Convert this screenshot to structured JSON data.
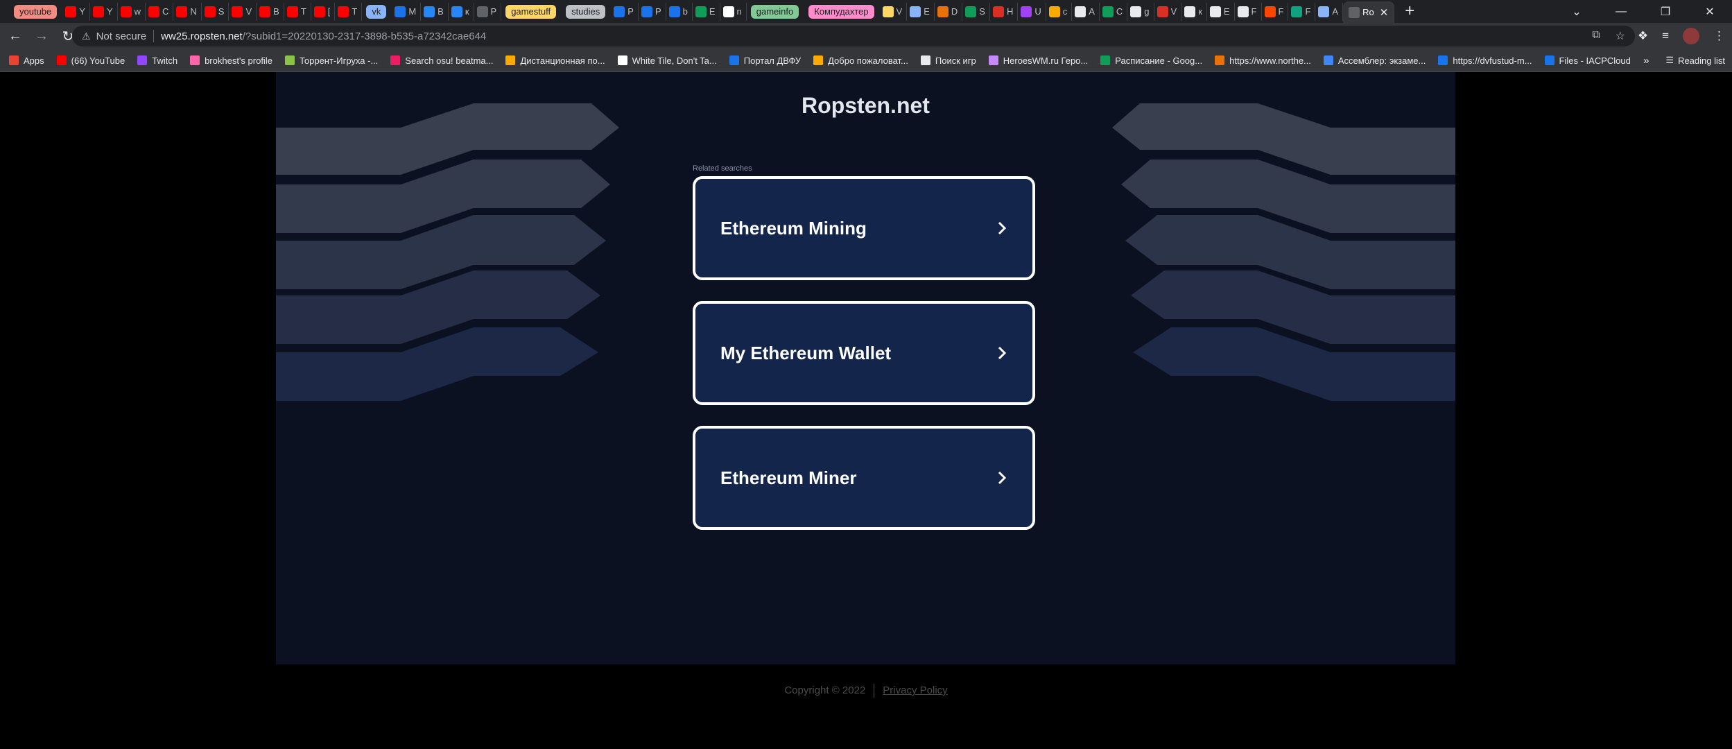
{
  "browser": {
    "tabs": [
      {
        "label": "youtube",
        "kind": "chip",
        "color": "#f28b82"
      },
      {
        "label": "Y",
        "icon": "youtube-icon",
        "color": "#ff0000"
      },
      {
        "label": "Y",
        "icon": "youtube-icon",
        "color": "#ff0000"
      },
      {
        "label": "w",
        "icon": "youtube-icon",
        "color": "#ff0000"
      },
      {
        "label": "C",
        "icon": "youtube-icon",
        "color": "#ff0000"
      },
      {
        "label": "N",
        "icon": "youtube-icon",
        "color": "#ff0000"
      },
      {
        "label": "S",
        "icon": "youtube-icon",
        "color": "#ff0000"
      },
      {
        "label": "V",
        "icon": "youtube-icon",
        "color": "#ff0000"
      },
      {
        "label": "B",
        "icon": "youtube-icon",
        "color": "#ff0000"
      },
      {
        "label": "T",
        "icon": "youtube-icon",
        "color": "#ff0000"
      },
      {
        "label": "[",
        "icon": "youtube-icon",
        "color": "#ff0000"
      },
      {
        "label": "T",
        "icon": "youtube-icon",
        "color": "#ff0000"
      },
      {
        "label": "vk",
        "kind": "chip",
        "color": "#8ab4f8"
      },
      {
        "label": "M",
        "icon": "chat-icon",
        "color": "#1a73e8"
      },
      {
        "label": "B",
        "icon": "vk-icon",
        "color": "#2787f5"
      },
      {
        "label": "к",
        "icon": "vk-icon",
        "color": "#2787f5"
      },
      {
        "label": "P",
        "icon": "globe-icon",
        "color": "#5f6368"
      },
      {
        "label": "gamestuff",
        "kind": "chip",
        "color": "#fdd663"
      },
      {
        "label": "studies",
        "kind": "chip",
        "color": "#bdc1c6"
      },
      {
        "label": "P",
        "icon": "dvfu-icon",
        "color": "#1a73e8"
      },
      {
        "label": "P",
        "icon": "dvfu-icon",
        "color": "#1a73e8"
      },
      {
        "label": "b",
        "icon": "sync-icon",
        "color": "#1a73e8"
      },
      {
        "label": "E",
        "icon": "sheets-icon",
        "color": "#0f9d58"
      },
      {
        "label": "n",
        "icon": "github-icon",
        "color": "#ffffff"
      },
      {
        "label": "gameinfo",
        "kind": "chip",
        "color": "#81c995"
      },
      {
        "label": "Компудахтер",
        "kind": "chip",
        "color": "#ff8bcb"
      },
      {
        "label": "V",
        "icon": "emoji-icon",
        "color": "#fdd663"
      },
      {
        "label": "E",
        "icon": "infinity-icon",
        "color": "#8ab4f8"
      },
      {
        "label": "D",
        "icon": "game-icon",
        "color": "#e8710a"
      },
      {
        "label": "S",
        "icon": "game-icon",
        "color": "#0f9d58"
      },
      {
        "label": "H",
        "icon": "letter-a-icon",
        "color": "#d93025"
      },
      {
        "label": "U",
        "icon": "figma-icon",
        "color": "#a142f4"
      },
      {
        "label": "c",
        "icon": "game-icon",
        "color": "#f9ab00"
      },
      {
        "label": "A",
        "icon": "pinwheel-icon",
        "color": "#e8eaed"
      },
      {
        "label": "C",
        "icon": "sheets-icon",
        "color": "#0f9d58"
      },
      {
        "label": "g",
        "icon": "google-icon",
        "color": "#e8eaed"
      },
      {
        "label": "V",
        "icon": "game-icon",
        "color": "#d93025"
      },
      {
        "label": "к",
        "icon": "google-icon",
        "color": "#e8eaed"
      },
      {
        "label": "E",
        "icon": "google-icon",
        "color": "#e8eaed"
      },
      {
        "label": "F",
        "icon": "google-icon",
        "color": "#e8eaed"
      },
      {
        "label": "F",
        "icon": "reddit-icon",
        "color": "#ff4500"
      },
      {
        "label": "F",
        "icon": "chatgpt-icon",
        "color": "#10a37f"
      },
      {
        "label": "A",
        "icon": "moon-icon",
        "color": "#8ab4f8"
      }
    ],
    "active_tab": {
      "label": "Ro",
      "close": "✕"
    },
    "new_tab": "+",
    "window_controls": {
      "dropdown": "⌄",
      "minimize": "—",
      "restore": "❐",
      "close": "✕"
    },
    "address_bar": {
      "security_icon": "⚠",
      "security_text": "Not secure",
      "host": "ww25.ropsten.net",
      "path": "/?subid1=20220130-2317-3898-b535-a72342cae644"
    },
    "bookmarks": [
      {
        "label": "Apps",
        "icon": "apps-icon",
        "color": "#ea4335"
      },
      {
        "label": "(66) YouTube",
        "icon": "youtube-icon",
        "color": "#ff0000"
      },
      {
        "label": "Twitch",
        "icon": "twitch-icon",
        "color": "#9146ff"
      },
      {
        "label": "brokhest's profile",
        "icon": "osu-icon",
        "color": "#ff66aa"
      },
      {
        "label": "Торрент-Игруха -...",
        "icon": "torrent-icon",
        "color": "#8bc34a"
      },
      {
        "label": "Search osu! beatma...",
        "icon": "osu-icon",
        "color": "#e91e63"
      },
      {
        "label": "Дистанционная по...",
        "icon": "dvfu-icon",
        "color": "#f9ab00"
      },
      {
        "label": "White Tile, Don't Ta...",
        "icon": "tiles-icon",
        "color": "#ffffff"
      },
      {
        "label": "Портал ДВФУ",
        "icon": "dvfu-icon",
        "color": "#1a73e8"
      },
      {
        "label": "Добро пожаловат...",
        "icon": "book-icon",
        "color": "#f9ab00"
      },
      {
        "label": "Поиск игр",
        "icon": "m-icon",
        "color": "#e8eaed"
      },
      {
        "label": "HeroesWM.ru Геро...",
        "icon": "sword-icon",
        "color": "#c58af9"
      },
      {
        "label": "Расписание - Goog...",
        "icon": "sheets-icon",
        "color": "#0f9d58"
      },
      {
        "label": "https://www.northe...",
        "icon": "globe-icon",
        "color": "#e8710a"
      },
      {
        "label": "Ассемблер: экзаме...",
        "icon": "doc-icon",
        "color": "#4285f4"
      },
      {
        "label": "https://dvfustud-m...",
        "icon": "cloud-icon",
        "color": "#1a73e8"
      },
      {
        "label": "Files - IACPCloud",
        "icon": "cloud-icon",
        "color": "#1a73e8"
      }
    ],
    "bookmarks_more": "»",
    "reading_list": "Reading list"
  },
  "page": {
    "site_title": "Ropsten.net",
    "related_label": "Related searches",
    "links": [
      {
        "label": "Ethereum Mining"
      },
      {
        "label": "My Ethereum Wallet"
      },
      {
        "label": "Ethereum Miner"
      }
    ],
    "footer": {
      "copyright": "Copyright © 2022",
      "privacy": "Privacy Policy"
    },
    "colors": {
      "background": "#0b1121",
      "card": "#13254b",
      "card_border": "#ffffff"
    }
  }
}
